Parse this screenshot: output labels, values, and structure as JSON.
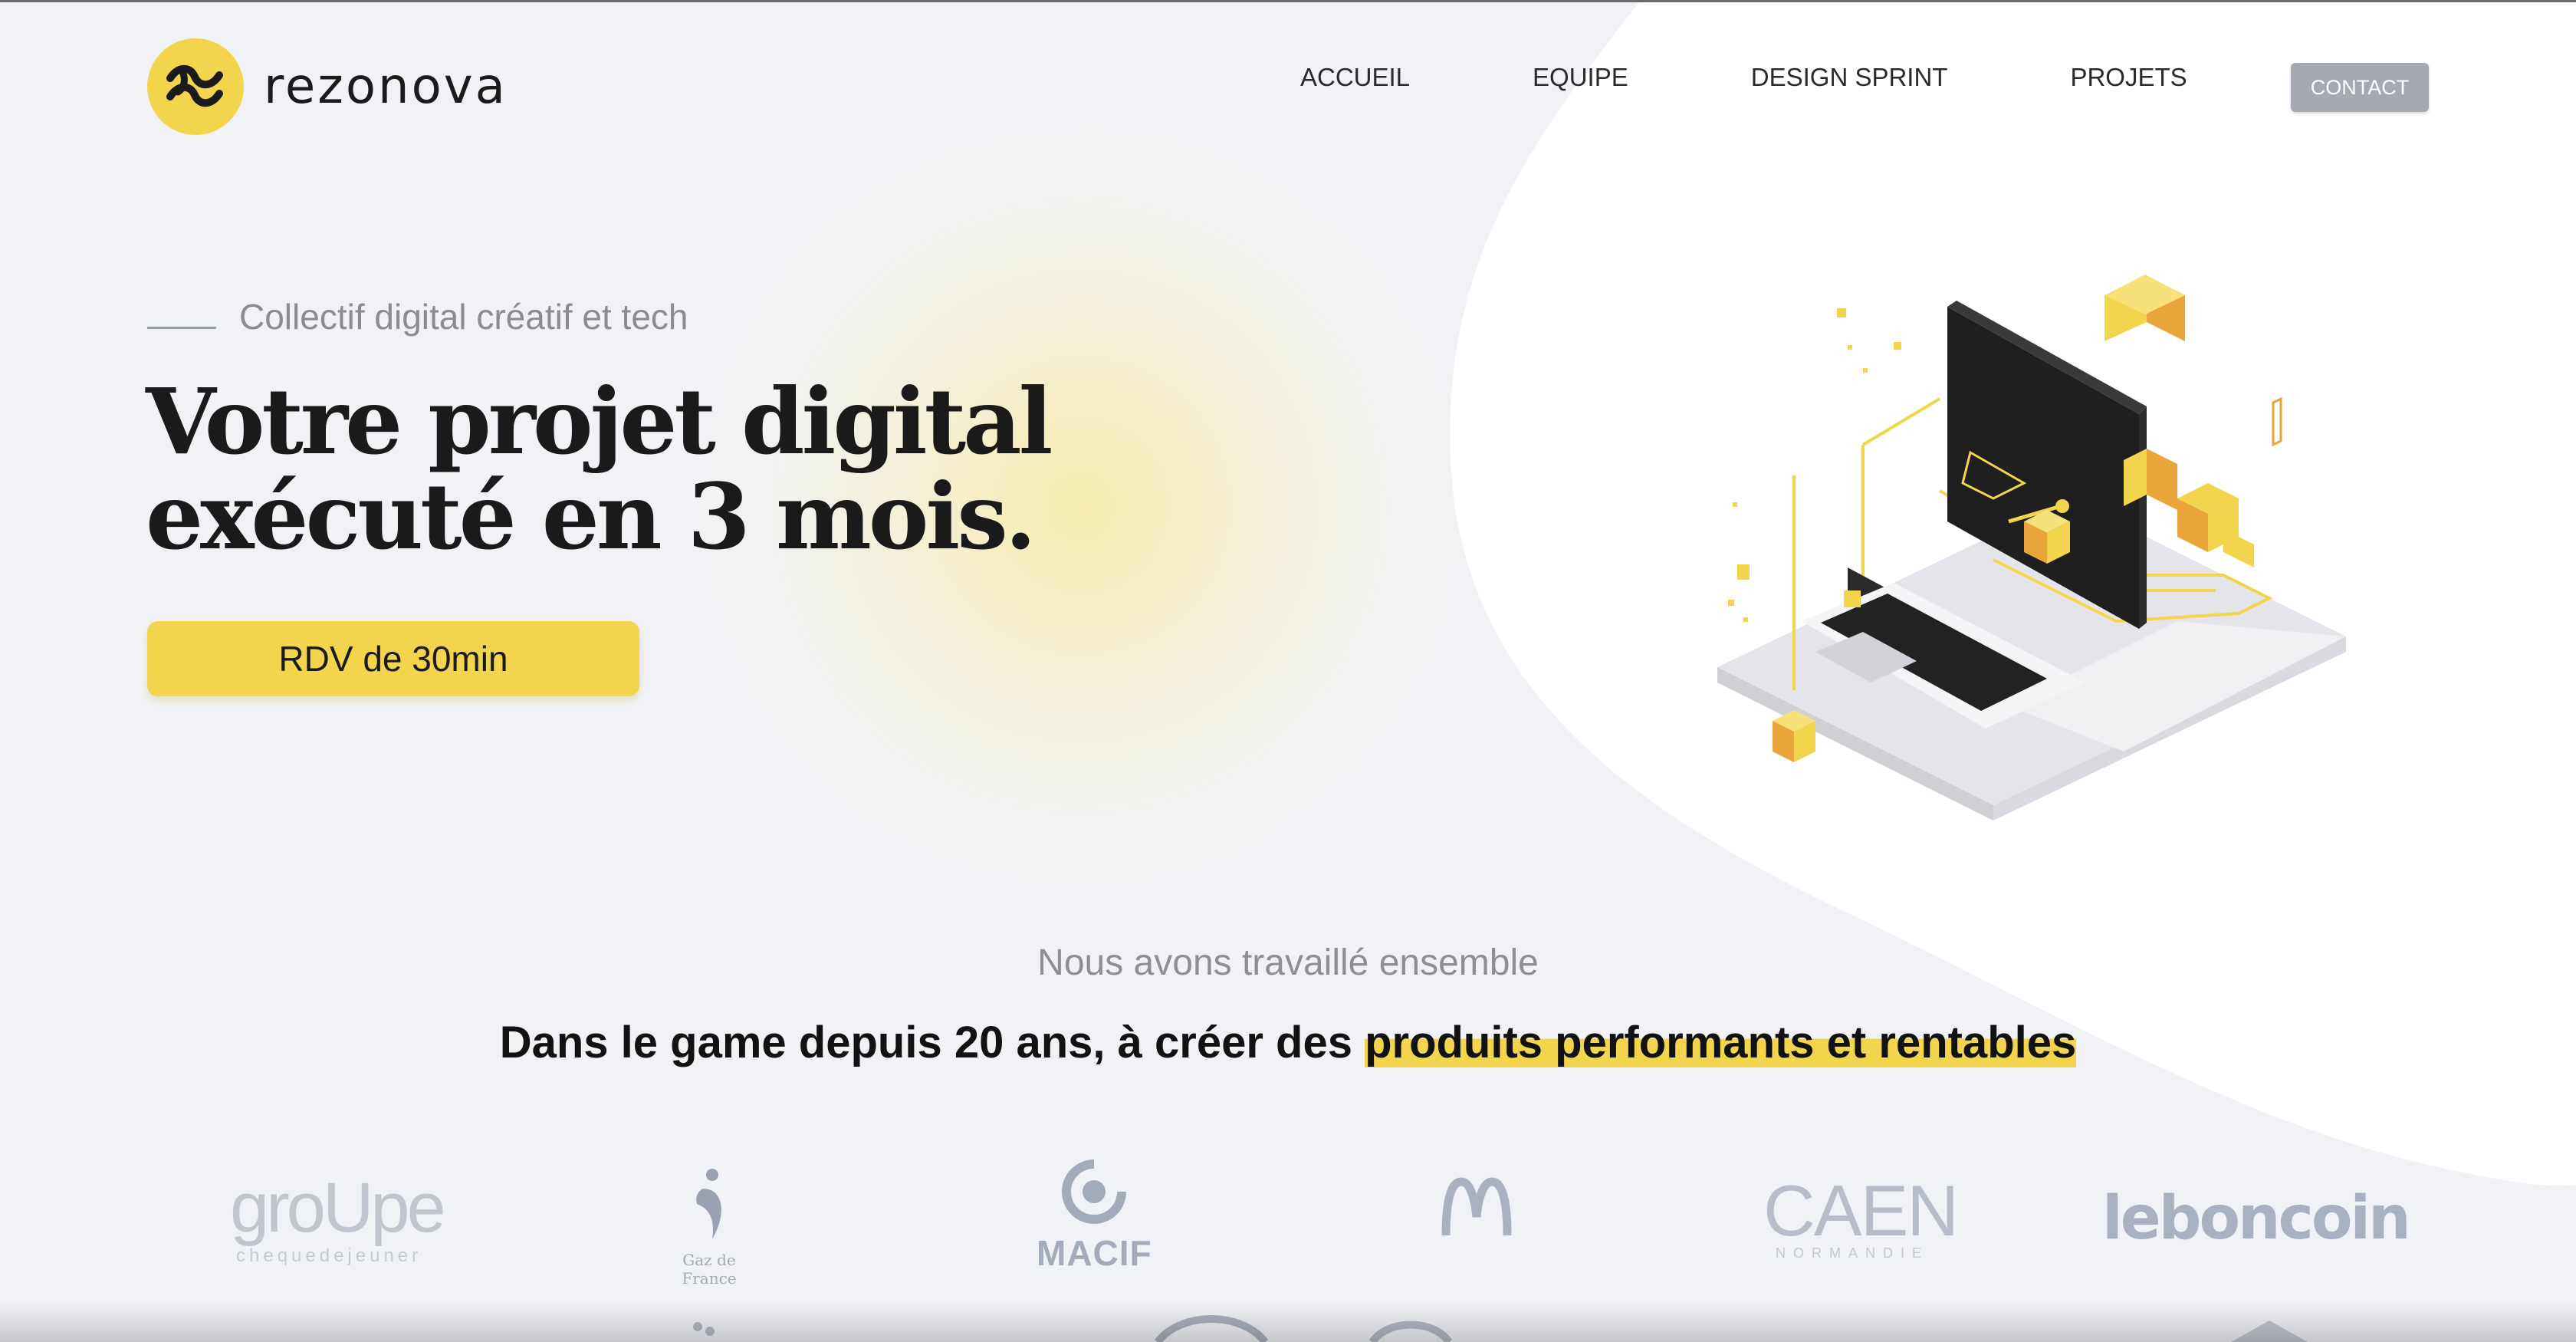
{
  "brand": {
    "name": "rezonova",
    "colors": {
      "accent": "#f2d54d",
      "background": "#f1f2f6",
      "text": "#1b1b1b",
      "muted": "#8a8c92",
      "contact_button": "#a5aab2"
    }
  },
  "nav": {
    "items": [
      {
        "label": "ACCUEIL"
      },
      {
        "label": "EQUIPE"
      },
      {
        "label": "DESIGN SPRINT"
      },
      {
        "label": "PROJETS"
      }
    ],
    "contact_label": "CONTACT"
  },
  "hero": {
    "tagline": "Collectif digital créatif et tech",
    "title_line1": "Votre projet digital",
    "title_line2": "exécuté en 3 mois.",
    "cta_label": "RDV de 30min",
    "illustration_icon": "isometric-computer-laptop-illustration"
  },
  "clients_section": {
    "subtitle": "Nous avons travaillé ensemble",
    "title_plain": "Dans le game depuis 20 ans, à créer des ",
    "title_highlight": "produits performants et rentables",
    "logos": [
      {
        "name": "groUpe chequedejeuner",
        "text_big": "groUpe",
        "text_small": "chequedejeuner"
      },
      {
        "name": "Gaz de France",
        "text_small": "Gaz de France"
      },
      {
        "name": "MACIF",
        "text": "MACIF"
      },
      {
        "name": "McDonald's",
        "icon": "mcdonalds-arches-icon"
      },
      {
        "name": "CAEN Normandie",
        "text_big": "CAEN",
        "text_small": "NORMANDIE"
      },
      {
        "name": "leboncoin",
        "text": "leboncoin"
      }
    ]
  }
}
